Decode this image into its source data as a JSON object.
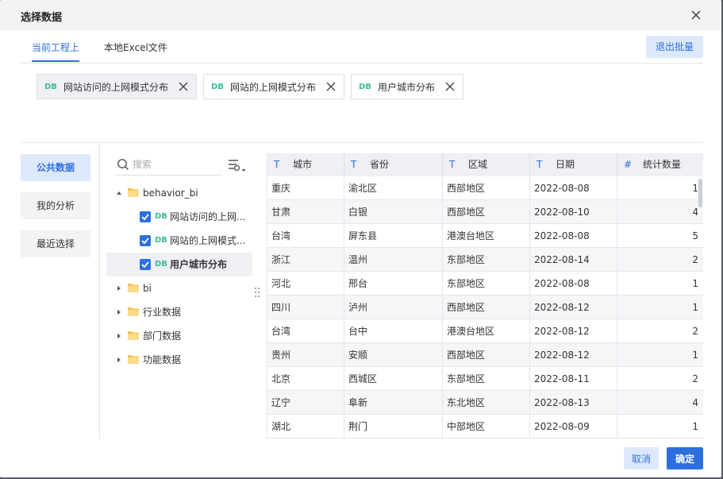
{
  "dialog": {
    "title": "选择数据"
  },
  "tabs": [
    {
      "label": "当前工程上",
      "active": true
    },
    {
      "label": "本地Excel文件",
      "active": false
    }
  ],
  "exit_batch_label": "退出批量",
  "chips": [
    {
      "tag": "DB",
      "label": "网站访问的上网模式分布"
    },
    {
      "tag": "DB",
      "label": "网站的上网模式分布"
    },
    {
      "tag": "DB",
      "label": "用户城市分布"
    }
  ],
  "nav": [
    {
      "label": "公共数据",
      "active": true
    },
    {
      "label": "我的分析",
      "active": false
    },
    {
      "label": "最近选择",
      "active": false
    }
  ],
  "search": {
    "placeholder": "搜索"
  },
  "tree": {
    "root": {
      "label": "behavior_bi",
      "expanded": true
    },
    "children": [
      {
        "tag": "DB",
        "label": "网站访问的上网...",
        "checked": true
      },
      {
        "tag": "DB",
        "label": "网站的上网模式...",
        "checked": true
      },
      {
        "tag": "DB",
        "label": "用户城市分布",
        "checked": true,
        "selected": true
      }
    ],
    "folders": [
      {
        "label": "bi"
      },
      {
        "label": "行业数据"
      },
      {
        "label": "部门数据"
      },
      {
        "label": "功能数据"
      }
    ]
  },
  "table": {
    "columns": [
      {
        "icon": "T",
        "label": "城市"
      },
      {
        "icon": "T",
        "label": "省份"
      },
      {
        "icon": "T",
        "label": "区域"
      },
      {
        "icon": "T",
        "label": "日期"
      },
      {
        "icon": "#",
        "label": "统计数量"
      }
    ],
    "rows": [
      [
        "重庆",
        "渝北区",
        "西部地区",
        "2022-08-08",
        "1"
      ],
      [
        "甘肃",
        "白银",
        "西部地区",
        "2022-08-10",
        "4"
      ],
      [
        "台湾",
        "屏东县",
        "港澳台地区",
        "2022-08-08",
        "5"
      ],
      [
        "浙江",
        "温州",
        "东部地区",
        "2022-08-14",
        "2"
      ],
      [
        "河北",
        "邢台",
        "东部地区",
        "2022-08-08",
        "1"
      ],
      [
        "四川",
        "泸州",
        "西部地区",
        "2022-08-12",
        "1"
      ],
      [
        "台湾",
        "台中",
        "港澳台地区",
        "2022-08-12",
        "2"
      ],
      [
        "贵州",
        "安顺",
        "西部地区",
        "2022-08-12",
        "1"
      ],
      [
        "北京",
        "西城区",
        "东部地区",
        "2022-08-11",
        "2"
      ],
      [
        "辽宁",
        "阜新",
        "东北地区",
        "2022-08-13",
        "4"
      ],
      [
        "湖北",
        "荆门",
        "中部地区",
        "2022-08-09",
        "1"
      ]
    ]
  },
  "footer": {
    "cancel_label": "取消",
    "ok_label": "确定"
  },
  "colors": {
    "primary": "#2e6fe0",
    "db_tag": "#3dbb9c",
    "folder": "#f5c451"
  }
}
